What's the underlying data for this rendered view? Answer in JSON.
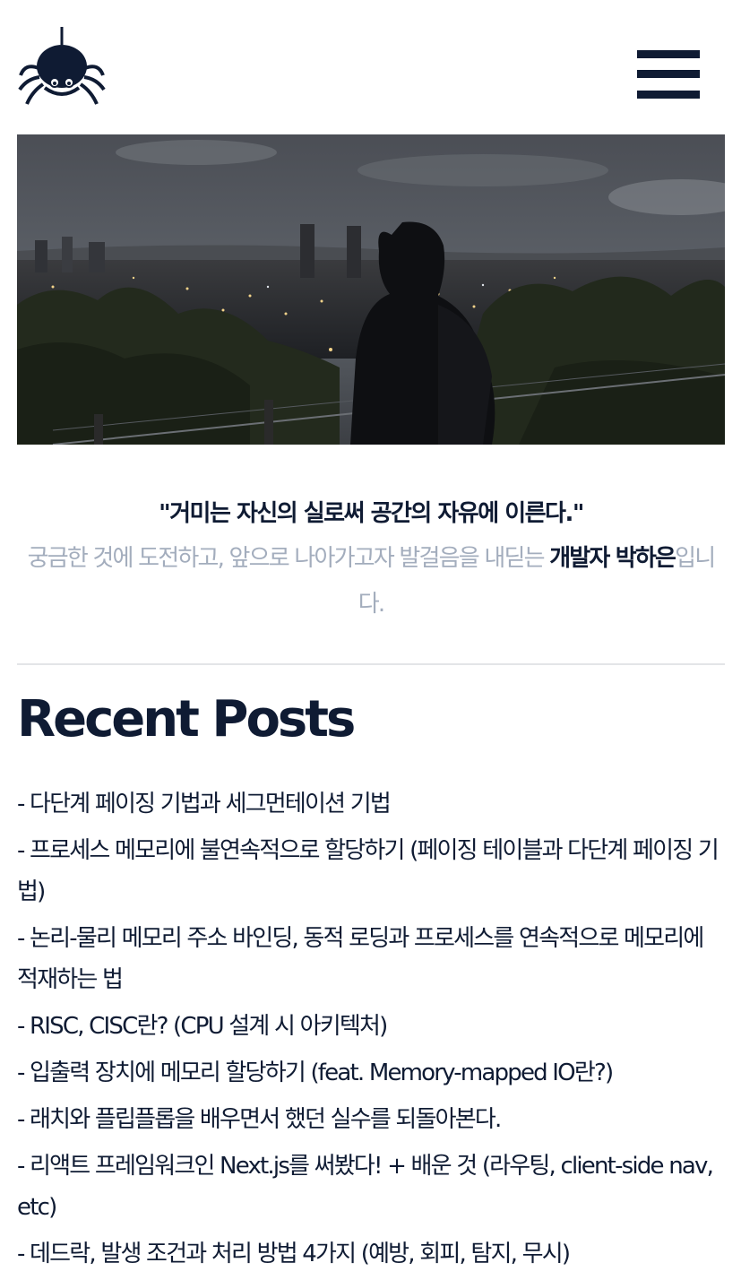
{
  "header": {
    "logo_icon": "spider-logo-icon",
    "menu_icon": "hamburger-menu-icon"
  },
  "hero": {
    "image_alt": "Night city skyline viewed from a hill with a person standing in the foreground"
  },
  "intro": {
    "quote": "\"거미는 자신의 실로써 공간의 자유에 이른다.\"",
    "desc_prefix": "궁금한 것에 도전하고, 앞으로 나아가고자 발걸음을 내딛는 ",
    "desc_highlight": "개발자 박하은",
    "desc_suffix": "입니다."
  },
  "recent_posts": {
    "title": "Recent Posts",
    "items": [
      "- 다단계 페이징 기법과 세그먼테이션 기법",
      "- 프로세스 메모리에 불연속적으로 할당하기 (페이징 테이블과 다단계 페이징 기법)",
      "- 논리-물리 메모리 주소 바인딩, 동적 로딩과 프로세스를 연속적으로 메모리에 적재하는 법",
      "- RISC, CISC란? (CPU 설계 시 아키텍처)",
      "- 입출력 장치에 메모리 할당하기 (feat. Memory-mapped IO란?)",
      "- 래치와 플립플롭을 배우면서 했던 실수를 되돌아본다.",
      "- 리액트 프레임워크인 Next.js를 써봤다! + 배운 것 (라우팅, client-side nav, etc)",
      "- 데드락, 발생 조건과 처리 방법 4가지 (예방, 회피, 탐지, 무시)"
    ]
  },
  "colors": {
    "brand_navy": "#0f1b33",
    "muted_text": "#a3adbd",
    "divider": "#e3e5e8"
  }
}
